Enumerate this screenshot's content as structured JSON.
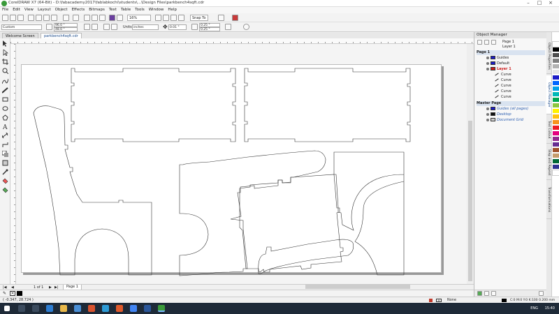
{
  "window": {
    "title": "CorelDRAW X7 (64-Bit) - D:\\fabacademy2017\\fablabkochi\\students\\...\\Design Files\\parkbench4sqft.cdr"
  },
  "menu": [
    "File",
    "Edit",
    "View",
    "Layout",
    "Object",
    "Effects",
    "Bitmaps",
    "Text",
    "Table",
    "Tools",
    "Window",
    "Help"
  ],
  "toolbar": {
    "zoom": "16%",
    "snap_to": "Snap To"
  },
  "property_bar": {
    "page_size": "Custom",
    "width": "96.0 \"",
    "height": "48.0 \"",
    "units_label": "Units:",
    "units": "inches",
    "nudge": "0.01 \"",
    "dup_x": "0.25 \"",
    "dup_y": "0.25 \""
  },
  "tabs": {
    "welcome": "Welcome Screen",
    "file": "parkbench4sqft.cdr"
  },
  "page_nav": {
    "of": "1 of 1",
    "page_tab": "Page 1"
  },
  "docker": {
    "title": "Object Manager",
    "page": "Page 1",
    "layer": "Layer 1",
    "tree": [
      {
        "label": "Page 1",
        "kind": "page"
      },
      {
        "label": "Guides",
        "kind": "layer",
        "swatch": "#1c1cc8"
      },
      {
        "label": "Default",
        "kind": "layer",
        "swatch": "#1c1cc8"
      },
      {
        "label": "Layer 1",
        "kind": "layer-active",
        "swatch": "#cc1b1b"
      },
      {
        "label": "Curve",
        "kind": "object"
      },
      {
        "label": "Curve",
        "kind": "object"
      },
      {
        "label": "Curve",
        "kind": "object"
      },
      {
        "label": "Curve",
        "kind": "object"
      },
      {
        "label": "Curve",
        "kind": "object"
      },
      {
        "label": "Master Page",
        "kind": "page"
      },
      {
        "label": "Guides (all pages)",
        "kind": "master",
        "swatch": "#1c1cc8"
      },
      {
        "label": "Desktop",
        "kind": "master",
        "swatch": "#111111"
      },
      {
        "label": "Document Grid",
        "kind": "master",
        "swatch": "#cccccc"
      }
    ],
    "side_tabs": [
      "Object Properties",
      "Object Manager",
      "Text Cutout",
      "Step and Repeat",
      "Transformations"
    ]
  },
  "status": {
    "coords": "( -0.347, 28.724 )",
    "fill": "None",
    "outline": "C:0 M:0 Y:0 K:100  0.200 mm"
  },
  "taskbar": {
    "language": "ENG",
    "time": "15:40"
  },
  "colors": {
    "palette": [
      "#ffffff",
      "#000000",
      "#4d4d4d",
      "#808080",
      "#b3b3b3",
      "#e6e6e6",
      "#1c1cc8",
      "#0066ff",
      "#00a0e9",
      "#00b8b8",
      "#00a651",
      "#8dc63f",
      "#fff200",
      "#ffc20e",
      "#f7941d",
      "#ed1c24",
      "#e4007f",
      "#92278f",
      "#662d91",
      "#a0522d",
      "#c69c6d",
      "#006837",
      "#2e3192",
      "#ffffff"
    ]
  }
}
